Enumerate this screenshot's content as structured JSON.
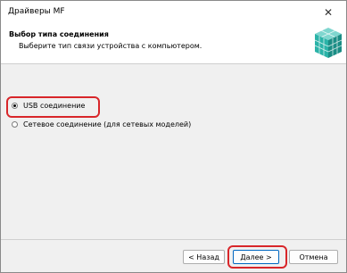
{
  "window": {
    "title": "Драйверы MF",
    "close_glyph": "✕"
  },
  "header": {
    "title": "Выбор типа соединения",
    "subtitle": "Выберите тип связи устройства с компьютером."
  },
  "options": [
    {
      "label": "USB соединение",
      "selected": true
    },
    {
      "label": "Сетевое соединение (для сетевых моделей)",
      "selected": false
    }
  ],
  "buttons": {
    "back": "< Назад",
    "next": "Далее >",
    "cancel": "Отмена"
  },
  "colors": {
    "highlight": "#d8262a",
    "accent": "#0067c0",
    "icon_teal": "#2bb3a8"
  }
}
